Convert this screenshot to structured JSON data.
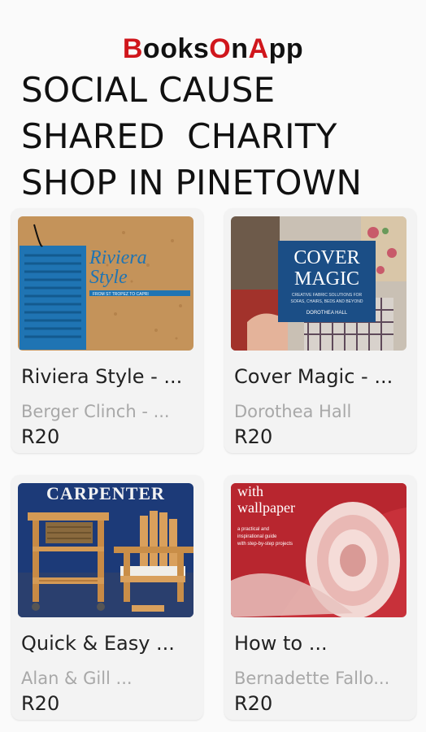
{
  "app": {
    "logo_red_1": "B",
    "logo_black_1": "ooks",
    "logo_red_2": "O",
    "logo_black_2": "n",
    "logo_red_3": "A",
    "logo_black_3": "pp",
    "brand_color": "#d0161c"
  },
  "shop": {
    "title_lines": [
      "SOCIAL CAUSE",
      "SHARED  CHARITY",
      "SHOP IN PINETOWN"
    ]
  },
  "books": [
    {
      "title": "Riviera Style - ...",
      "author": "Berger Clinch - ...",
      "price": "R20",
      "cover_text": [
        "Riviera",
        "Style",
        "FROM ST TROPEZ TO CAPRI"
      ]
    },
    {
      "title": "Cover Magic - ...",
      "author": "Dorothea Hall",
      "price": "R20",
      "cover_text": [
        "COVER",
        "MAGIC",
        "CREATIVE FABRIC SOLUTIONS FOR",
        "SOFAS, CHAIRS, BEDS AND BEYOND",
        "DOROTHEA HALL"
      ]
    },
    {
      "title": "Quick & Easy ...",
      "author": "Alan & Gill ...",
      "price": "R20",
      "cover_text": [
        "CARPENTER"
      ]
    },
    {
      "title": "How to ...",
      "author": "Bernadette Fallo...",
      "price": "R20",
      "cover_text": [
        "with",
        "wallpaper",
        "a practical and",
        "inspirational guide",
        "with step-by-step projects"
      ]
    }
  ]
}
